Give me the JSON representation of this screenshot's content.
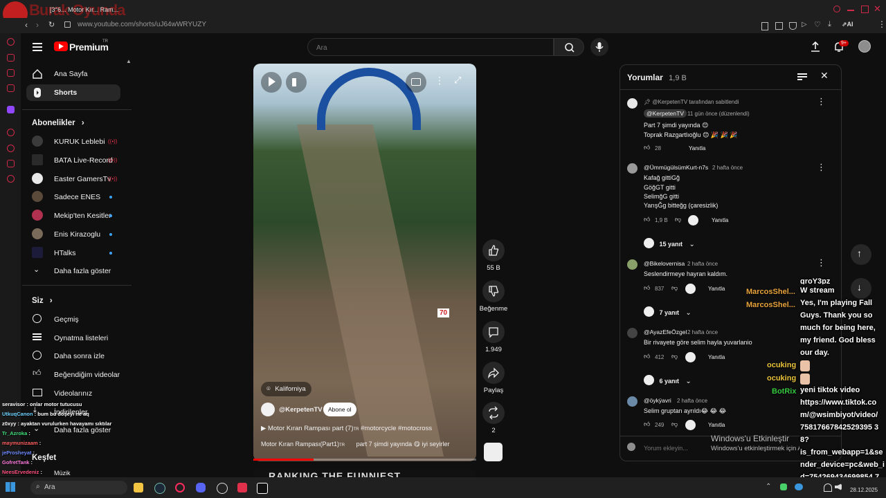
{
  "browser": {
    "tab_title": "[3°6... Motor Kır... Ram...",
    "url": "www.youtube.com/shorts/uJ64wWRYUZY",
    "overlay_logo_text": "Burak Oyunda"
  },
  "header": {
    "brand": "Premium",
    "brand_suffix": "TR",
    "search_placeholder": "Ara",
    "notif_badge": "9+"
  },
  "sidebar": {
    "main": [
      {
        "label": "Ana Sayfa",
        "icon": "home-icon"
      },
      {
        "label": "Shorts",
        "icon": "shorts-icon",
        "active": true
      }
    ],
    "subs_title": "Abonelikler",
    "subs": [
      {
        "label": "KURUK Leblebi",
        "live": true
      },
      {
        "label": "BATA Live-Record",
        "live": true
      },
      {
        "label": "Easter GamersTv",
        "live": true
      },
      {
        "label": "Sadece ENES",
        "dot": true
      },
      {
        "label": "Mekip'ten Kesitler",
        "dot": true
      },
      {
        "label": "Enis Kirazoglu",
        "dot": true
      },
      {
        "label": "HTalks",
        "dot": true
      }
    ],
    "show_more": "Daha fazla göster",
    "you_title": "Siz",
    "you": [
      {
        "label": "Geçmiş",
        "icon": "history-icon"
      },
      {
        "label": "Oynatma listeleri",
        "icon": "playlist-icon"
      },
      {
        "label": "Daha sonra izle",
        "icon": "clock-icon"
      },
      {
        "label": "Beğendiğim videolar",
        "icon": "like-icon"
      },
      {
        "label": "Videolarınız",
        "icon": "video-icon"
      },
      {
        "label": "İndirilenler",
        "icon": "download-icon"
      },
      {
        "label": "Daha fazla göster",
        "icon": "chevron-down-icon"
      }
    ],
    "explore_title": "Keşfet",
    "explore_item": "Müzik"
  },
  "video": {
    "location": "Kaliforniya",
    "channel": "@KerpetenTV",
    "subscribe": "Abone ol",
    "title": "Motor Kıran Rampası part (7)",
    "title_tags": "#motorcycle #motocross",
    "title_tr": "TR",
    "playlist": "Motor Kıran Rampası(Part1)",
    "playlist_tr": "TR",
    "playlist_note": "part 7 şimdi yayında 😋 iyi seyirler",
    "gate_number": "70",
    "next_banner": "RANKING THE FUNNIEST"
  },
  "actions": {
    "likes": "55 B",
    "dislike": "Beğenme",
    "comments": "1.949",
    "share": "Paylaş",
    "remix": "2"
  },
  "comments": {
    "title": "Yorumlar",
    "count": "1,9 B",
    "items": [
      {
        "pinned_by": "@KerpetenTV tarafından sabitlendi",
        "user": "@KerpetenTV",
        "time": "11 gün önce (düzenlendi)",
        "lines": [
          "Part 7 şimdi yayında 😊",
          "Toprak Razgartlıoğlu 😊 🎉 🎉 🎉"
        ],
        "likes": "28",
        "reply": "Yanıtla"
      },
      {
        "user": "@ÜmmügülsümKurt-n7s",
        "time": "2 hafta önce",
        "lines": [
          "Kafağ gittiGğ",
          "GöğGT gitti",
          "SelimğG gitti",
          "YarışĞg bitteğg (çaresizlik)"
        ],
        "likes": "1,9 B",
        "reply": "Yanıtla",
        "replies": "15 yanıt"
      },
      {
        "user": "@Bikelovernisa",
        "time": "2 hafta önce",
        "lines": [
          "Seslendirmeye hayran kaldım."
        ],
        "likes": "837",
        "reply": "Yanıtla",
        "replies": "7 yanıt"
      },
      {
        "user": "@AyazEfeÖzgel",
        "time": "2 hafta önce",
        "lines": [
          "Bir rivayete göre selim hayla yuvarlanio"
        ],
        "likes": "412",
        "reply": "Yanıtla",
        "replies": "6 yanıt"
      },
      {
        "user": "@öykÿavri",
        "time": "2 hafta önce",
        "lines": [
          "Selim gruptan ayrıldı😂 😂 😂"
        ],
        "likes": "249",
        "reply": "Yanıtla"
      }
    ],
    "input_placeholder": "Yorum ekleyin..."
  },
  "stream_chat_right": {
    "names": [
      {
        "name": "MarcosShel...",
        "color": "#e8a33a"
      },
      {
        "name": "MarcosShel...",
        "color": "#e8a33a"
      },
      {
        "name": "ocuking",
        "color": "#e8c23a"
      },
      {
        "name": "ocuking",
        "color": "#e8c23a"
      },
      {
        "name": "BotRix",
        "color": "#36c93f"
      }
    ],
    "lines": [
      "groY3pz",
      "W stream",
      "Yes, I'm playing Fall",
      "Guys. Thank you so",
      "much for being here,",
      "my friend. God bless",
      "our day.",
      "",
      "yeni tiktok video",
      "https://www.tiktok.co",
      "m/@wsimbiyot/video/",
      "75817667842529395 3",
      "8?",
      "is_from_webapp=1&se",
      "nder_device=pc&web_i",
      "d=754269434699854 7"
    ]
  },
  "stream_chat_left": [
    {
      "name": "seravisor",
      "text": "onlar motor tutucusu",
      "color": "#ffffff"
    },
    {
      "name": "UtkuqCanon",
      "text": "bum bu döşeyi ne aq",
      "color": "#6fd3ff"
    },
    {
      "name": "z0xyy",
      "text": "ayaktan vurulurken havayamı sıktılar",
      "color": "#ffffff"
    },
    {
      "name": "Tr_Azroka",
      "text": "",
      "color": "#40e07a"
    },
    {
      "name": "maymunizaam",
      "text": "",
      "color": "#ff6060"
    },
    {
      "name": "jeProsheyat",
      "text": "",
      "color": "#6f8bff"
    },
    {
      "name": "GofretTank",
      "text": "",
      "color": "#ff7de0"
    },
    {
      "name": "NeesErvedeniz",
      "text": "",
      "color": "#ff5080"
    }
  ],
  "windows_watermark": {
    "line1": "Windows'u Etkinleştir",
    "line2": "Windows'u etkinleştirmek için Ayarlar"
  },
  "taskbar": {
    "search": "Ara",
    "clock_time": "",
    "date": "28.12.2025"
  }
}
